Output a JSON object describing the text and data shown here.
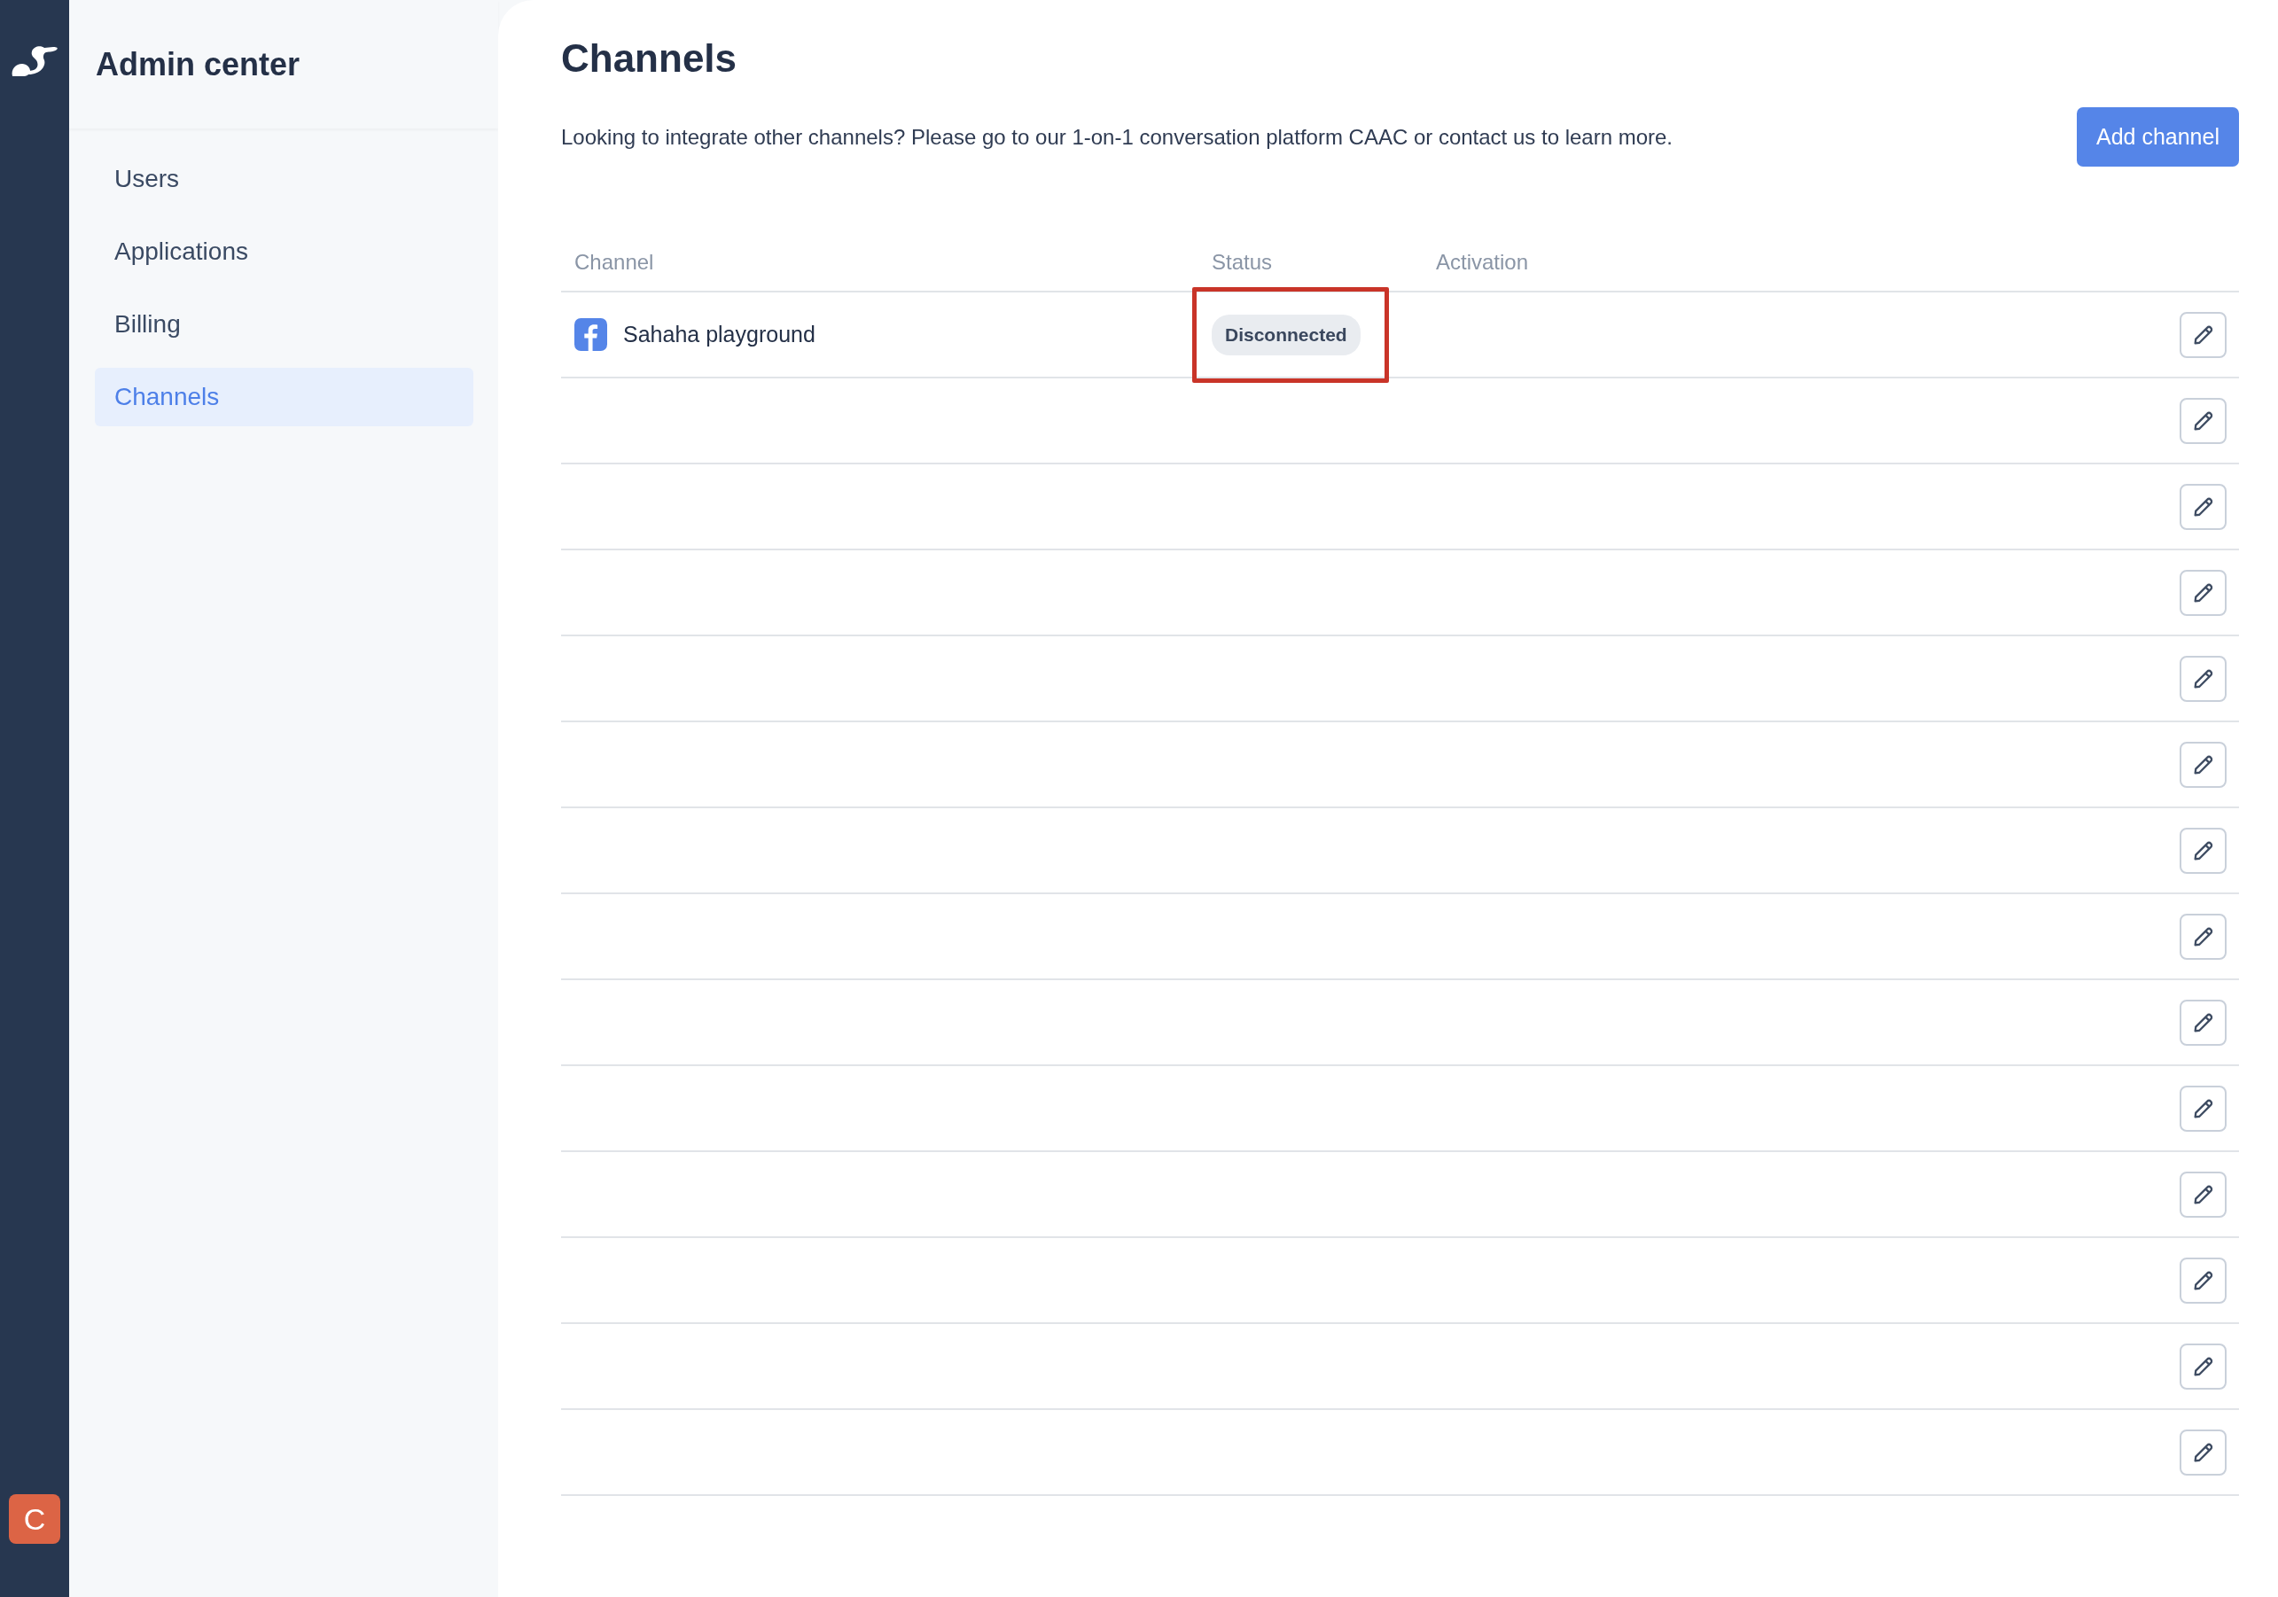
{
  "rail": {
    "avatar": "C"
  },
  "sidebar": {
    "title": "Admin center",
    "items": [
      {
        "label": "Users",
        "selected": false
      },
      {
        "label": "Applications",
        "selected": false
      },
      {
        "label": "Billing",
        "selected": false
      },
      {
        "label": "Channels",
        "selected": true
      }
    ]
  },
  "page": {
    "title": "Channels",
    "description": "Looking to integrate other channels? Please go to our 1-on-1 conversation platform CAAC or contact us to learn more.",
    "add_button": "Add channel"
  },
  "table": {
    "columns": [
      "Channel",
      "Status",
      "Activation"
    ],
    "rows": [
      {
        "kind": "channel",
        "channel": "Sahaha playground",
        "status": "Disconnected",
        "highlighted": true
      },
      {
        "kind": "blank"
      },
      {
        "kind": "blank"
      },
      {
        "kind": "blank"
      },
      {
        "kind": "blank"
      },
      {
        "kind": "blank"
      },
      {
        "kind": "blank"
      },
      {
        "kind": "blank"
      },
      {
        "kind": "blank"
      },
      {
        "kind": "blank"
      },
      {
        "kind": "blank"
      },
      {
        "kind": "blank"
      },
      {
        "kind": "blank"
      },
      {
        "kind": "blank"
      }
    ]
  }
}
